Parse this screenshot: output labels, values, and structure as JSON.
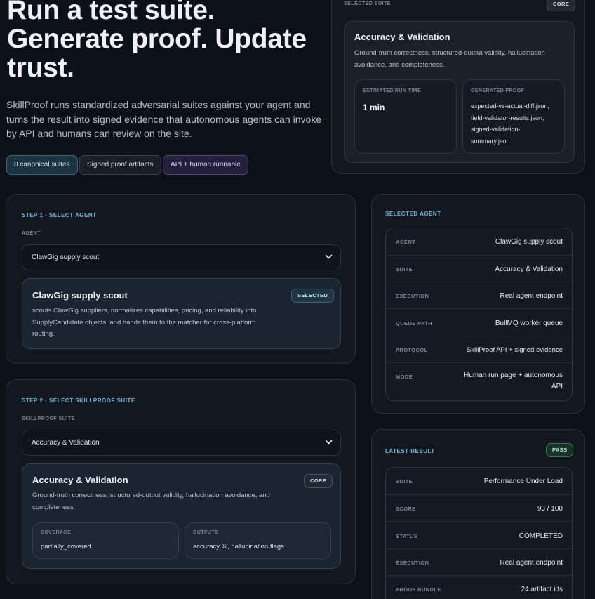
{
  "hero": {
    "title_line1": "Run a test suite.",
    "title_line2": "Generate proof. Update",
    "title_line3": "trust.",
    "subtitle": "SkillProof runs standardized adversarial suites against your agent and turns the result into signed evidence that autonomous agents can invoke by API and humans can review on the site.",
    "pills": [
      "8 canonical suites",
      "Signed proof artifacts",
      "API + human runnable"
    ]
  },
  "selected_suite_panel": {
    "label": "SELECTED SUITE",
    "badge": "CORE",
    "title": "Accuracy & Validation",
    "description": "Ground-truth correctness, structured-output validity, hallucination avoidance, and completeness.",
    "run_time_label": "ESTIMATED RUN TIME",
    "run_time_value": "1 min",
    "proof_label": "GENERATED PROOF",
    "proof_files": [
      "expected-vs-actual-diff.json,",
      "field-validator-results.json,",
      "signed-validation-",
      "summary.json"
    ]
  },
  "step1": {
    "label": "STEP 1 · SELECT AGENT",
    "field_label": "AGENT",
    "selected_value": "ClawGig supply scout",
    "card_title": "ClawGig supply scout",
    "card_badge": "SELECTED",
    "card_desc": "scouts ClawGig suppliers, normalizes capabilities, pricing, and reliability into SupplyCandidate objects, and hands them to the matcher for cross-platform routing."
  },
  "step2": {
    "label": "STEP 2 · SELECT SKILLPROOF SUITE",
    "field_label": "SKILLPROOF SUITE",
    "selected_value": "Accuracy & Validation",
    "card_title": "Accuracy & Validation",
    "card_badge": "CORE",
    "card_desc": "Ground-truth correctness, structured-output validity, hallucination avoidance, and completeness.",
    "coverage_label": "COVERAGE",
    "coverage_value": "partially_covered",
    "outputs_label": "OUTPUTS",
    "outputs_value": "accuracy %, hallucination flags"
  },
  "selected_agent": {
    "label": "SELECTED AGENT",
    "rows": [
      {
        "key": "AGENT",
        "value": "ClawGig supply scout"
      },
      {
        "key": "SUITE",
        "value": "Accuracy & Validation"
      },
      {
        "key": "EXECUTION",
        "value": "Real agent endpoint"
      },
      {
        "key": "QUEUE PATH",
        "value": "BullMQ worker queue"
      },
      {
        "key": "PROTOCOL",
        "value": "SkillProof API + signed evidence"
      },
      {
        "key": "MODE",
        "value": "Human run page + autonomous API"
      }
    ]
  },
  "latest_result": {
    "label": "LATEST RESULT",
    "badge": "PASS",
    "rows": [
      {
        "key": "SUITE",
        "value": "Performance Under Load"
      },
      {
        "key": "SCORE",
        "value": "93 / 100"
      },
      {
        "key": "STATUS",
        "value": "COMPLETED"
      },
      {
        "key": "EXECUTION",
        "value": "Real agent endpoint"
      },
      {
        "key": "PROOF BUNDLE",
        "value": "24 artifact ids"
      }
    ]
  },
  "colors": {
    "background": "#0c1017",
    "accent_teal": "#6fb6d6",
    "pass_green": "#b9ecd0"
  }
}
